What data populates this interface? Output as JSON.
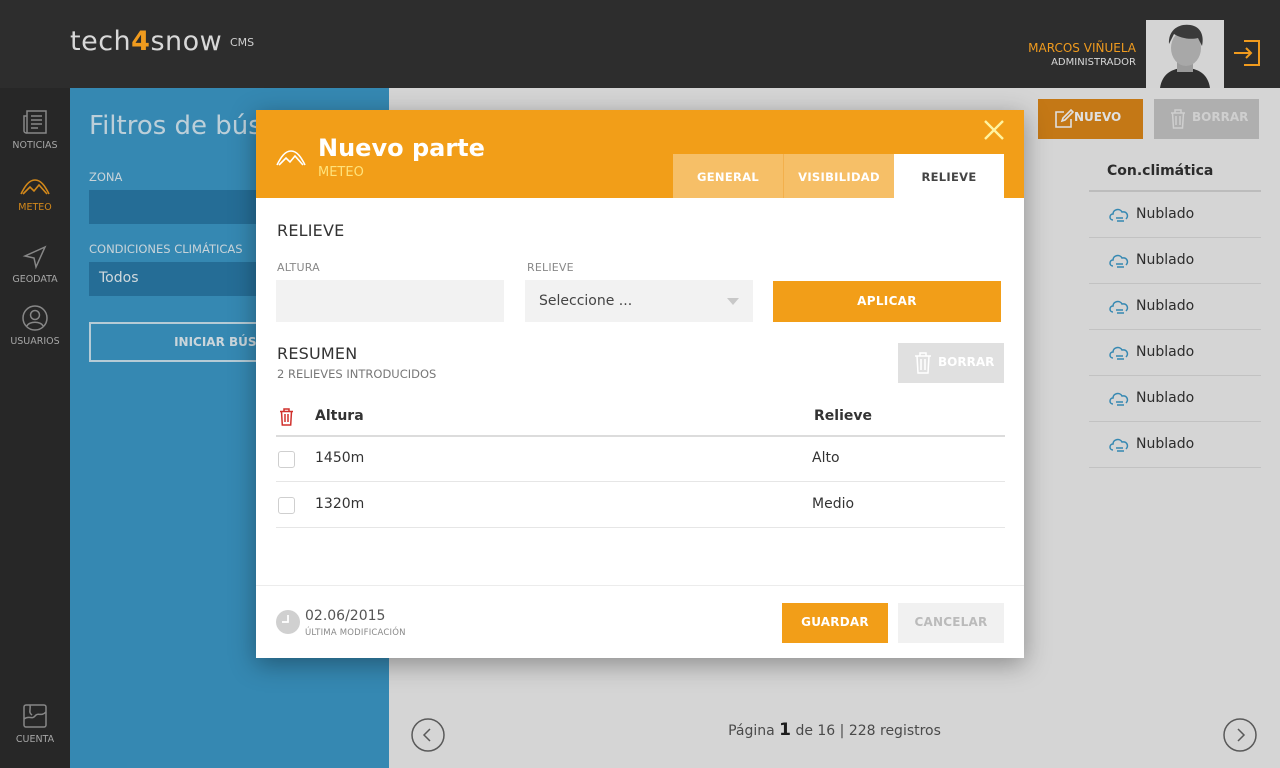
{
  "header": {
    "logo_prefix": "tech",
    "logo_four": "4",
    "logo_suffix": "snow",
    "logo_tag": "CMS",
    "user_name": "MARCOS VIÑUELA",
    "user_role": "ADMINISTRADOR"
  },
  "nav": {
    "items": [
      {
        "label": "NOTICIAS",
        "icon": "newspaper-icon"
      },
      {
        "label": "METEO",
        "icon": "mountain-icon",
        "active": true
      },
      {
        "label": "GEODATA",
        "icon": "navigation-icon"
      },
      {
        "label": "USUARIOS",
        "icon": "user-icon"
      }
    ],
    "bottom": {
      "label": "CUENTA",
      "icon": "map-icon"
    }
  },
  "filters": {
    "title": "Filtros de búsqueda",
    "zona_label": "ZONA",
    "zona_value": "",
    "condiciones_label": "CONDICIONES CLIMÁTICAS",
    "condiciones_value": "Todos",
    "search_button": "INICIAR BÚSQUEDA"
  },
  "list": {
    "new_button": "NUEVO",
    "delete_button": "BORRAR",
    "column_header": "Con.climática",
    "statuses": [
      "Nublado",
      "Nublado",
      "Nublado",
      "Nublado",
      "Nublado",
      "Nublado"
    ],
    "pager_prefix": "Página",
    "pager_page": "1",
    "pager_suffix": "de 16 | 228 registros"
  },
  "modal": {
    "title": "Nuevo parte",
    "subtitle": "METEO",
    "tabs": [
      "GENERAL",
      "VISIBILIDAD",
      "RELIEVE"
    ],
    "active_tab": "RELIEVE",
    "section_title": "RELIEVE",
    "altura_label": "ALTURA",
    "altura_value": "",
    "relieve_label": "RELIEVE",
    "relieve_select": "Seleccione ...",
    "apply_button": "APLICAR",
    "summary_title": "RESUMEN",
    "summary_count": "2 RELIEVES INTRODUCIDOS",
    "delete_button": "BORRAR",
    "table": {
      "col_altura": "Altura",
      "col_relieve": "Relieve",
      "rows": [
        {
          "altura": "1450m",
          "relieve": "Alto"
        },
        {
          "altura": "1320m",
          "relieve": "Medio"
        }
      ]
    },
    "footer": {
      "date": "02.06/2015",
      "date_label": "ÚLTIMA MODIFICACIÓN",
      "save_button": "GUARDAR",
      "cancel_button": "CANCELAR"
    }
  },
  "colors": {
    "accent": "#f29e18",
    "panel_blue": "#3d9bcb",
    "dark": "#2d2d2d"
  }
}
